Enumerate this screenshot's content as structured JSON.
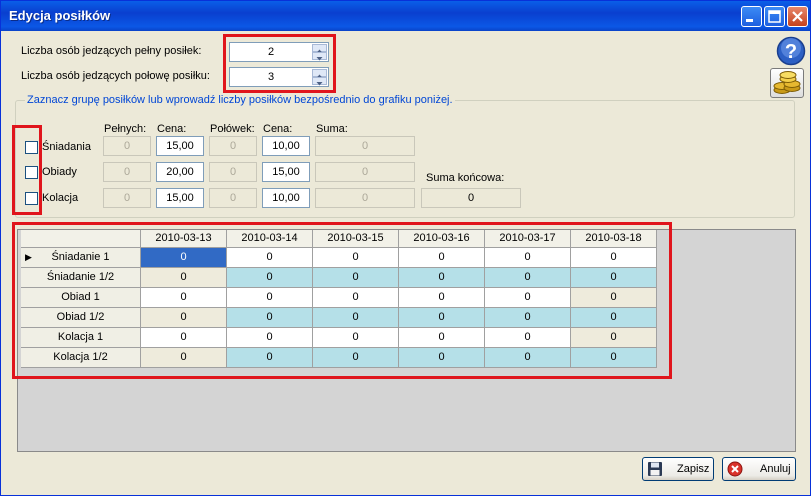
{
  "window": {
    "title": "Edycja posiłków"
  },
  "counts": {
    "full_label": "Liczba osób jedzących pełny posiłek:",
    "full_value": "2",
    "half_label": "Liczba osób jedzących połowę posiłku:",
    "half_value": "3"
  },
  "group": {
    "title": "Zaznacz grupę posiłków lub wprowadź liczby posiłków bezpośrednio do grafiku poniżej.",
    "headers": {
      "full": "Pełnych:",
      "price": "Cena:",
      "half": "Połówek:",
      "price2": "Cena:",
      "sum": "Suma:"
    },
    "meals": [
      {
        "name": "Śniadania",
        "full": "0",
        "price": "15,00",
        "half": "0",
        "price2": "10,00",
        "sum": "0"
      },
      {
        "name": "Obiady",
        "full": "0",
        "price": "20,00",
        "half": "0",
        "price2": "15,00",
        "sum": "0"
      },
      {
        "name": "Kolacja",
        "full": "0",
        "price": "15,00",
        "half": "0",
        "price2": "10,00",
        "sum": "0"
      }
    ],
    "total_label": "Suma końcowa:",
    "total_value": "0"
  },
  "grid": {
    "dates": [
      "2010-03-13",
      "2010-03-14",
      "2010-03-15",
      "2010-03-16",
      "2010-03-17",
      "2010-03-18"
    ],
    "rows": [
      {
        "name": "Śniadanie 1",
        "values": [
          "0",
          "0",
          "0",
          "0",
          "0",
          "0"
        ]
      },
      {
        "name": "Śniadanie 1/2",
        "values": [
          "0",
          "0",
          "0",
          "0",
          "0",
          "0"
        ]
      },
      {
        "name": "Obiad 1",
        "values": [
          "0",
          "0",
          "0",
          "0",
          "0",
          "0"
        ]
      },
      {
        "name": "Obiad 1/2",
        "values": [
          "0",
          "0",
          "0",
          "0",
          "0",
          "0"
        ]
      },
      {
        "name": "Kolacja 1",
        "values": [
          "0",
          "0",
          "0",
          "0",
          "0",
          "0"
        ]
      },
      {
        "name": "Kolacja 1/2",
        "values": [
          "0",
          "0",
          "0",
          "0",
          "0",
          "0"
        ]
      }
    ]
  },
  "buttons": {
    "save": "Zapisz",
    "cancel": "Anuluj"
  },
  "icons": {
    "help": "help-icon",
    "coins": "coins-icon",
    "save": "floppy-disk-icon",
    "cancel": "cancel-icon"
  }
}
